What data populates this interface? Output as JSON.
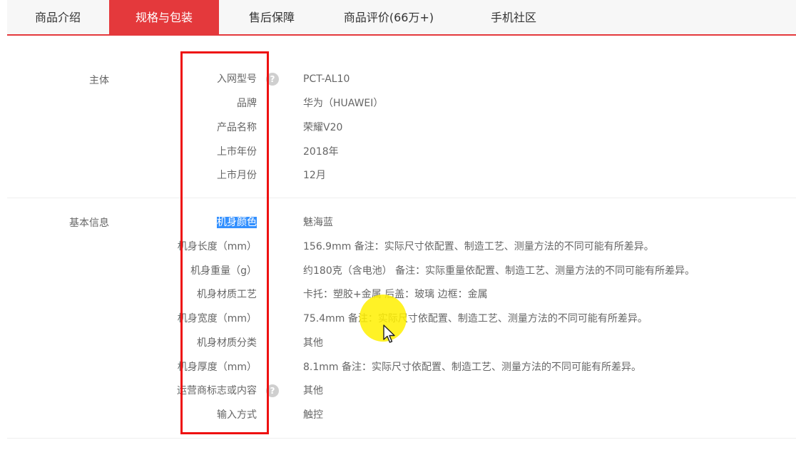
{
  "tabs": [
    {
      "label": "商品介绍",
      "active": false
    },
    {
      "label": "规格与包装",
      "active": true
    },
    {
      "label": "售后保障",
      "active": false
    },
    {
      "label": "商品评价(66万+)",
      "active": false
    },
    {
      "label": "手机社区",
      "active": false
    }
  ],
  "sections": {
    "main": {
      "title": "主体",
      "rows": [
        {
          "label": "入网型号",
          "value": "PCT-AL10",
          "help_icon": true
        },
        {
          "label": "品牌",
          "value": "华为（HUAWEI）"
        },
        {
          "label": "产品名称",
          "value": "荣耀V20"
        },
        {
          "label": "上市年份",
          "value": "2018年"
        },
        {
          "label": "上市月份",
          "value": "12月"
        }
      ]
    },
    "basic": {
      "title": "基本信息",
      "rows": [
        {
          "label": "机身颜色",
          "value": "魅海蓝",
          "selected": true
        },
        {
          "label": "机身长度（mm）",
          "value": "156.9mm 备注：实际尺寸依配置、制造工艺、测量方法的不同可能有所差异。"
        },
        {
          "label": "机身重量（g）",
          "value": "约180克（含电池） 备注：实际重量依配置、制造工艺、测量方法的不同可能有所差异。"
        },
        {
          "label": "机身材质工艺",
          "value": "卡托：塑胶+金属 后盖：玻璃 边框：金属"
        },
        {
          "label": "机身宽度（mm）",
          "value": "75.4mm 备注：实际尺寸依配置、制造工艺、测量方法的不同可能有所差异。"
        },
        {
          "label": "机身材质分类",
          "value": "其他"
        },
        {
          "label": "机身厚度（mm）",
          "value": "8.1mm 备注：实际尺寸依配置、制造工艺、测量方法的不同可能有所差异。"
        },
        {
          "label": "运营商标志或内容",
          "value": "其他",
          "help_icon": true
        },
        {
          "label": "输入方式",
          "value": "触控"
        }
      ]
    }
  },
  "help_icon_glyph": "?",
  "colors": {
    "accent": "#e4393c",
    "highlight_box": "#ee1111",
    "selection": "#3390ff",
    "cursor_halo": "#fff000"
  }
}
